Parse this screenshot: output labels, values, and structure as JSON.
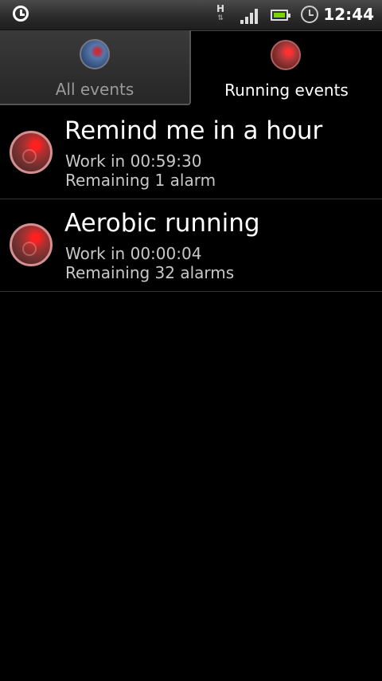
{
  "status_bar": {
    "network_type": "H",
    "time": "12:44",
    "icons": [
      "alarm-clock-app-icon",
      "data-transfer-icon",
      "signal-icon",
      "battery-icon",
      "alarm-icon"
    ]
  },
  "tabs": [
    {
      "label": "All events",
      "icon": "radar-blue-icon",
      "selected": false
    },
    {
      "label": "Running events",
      "icon": "radar-red-icon",
      "selected": true
    }
  ],
  "events": [
    {
      "title": "Remind me in a hour",
      "work_in": "Work in 00:59:30",
      "remaining": "Remaining 1 alarm",
      "icon": "radar-red-icon"
    },
    {
      "title": "Aerobic running",
      "work_in": "Work in 00:00:04",
      "remaining": "Remaining 32 alarms",
      "icon": "radar-red-icon"
    }
  ]
}
